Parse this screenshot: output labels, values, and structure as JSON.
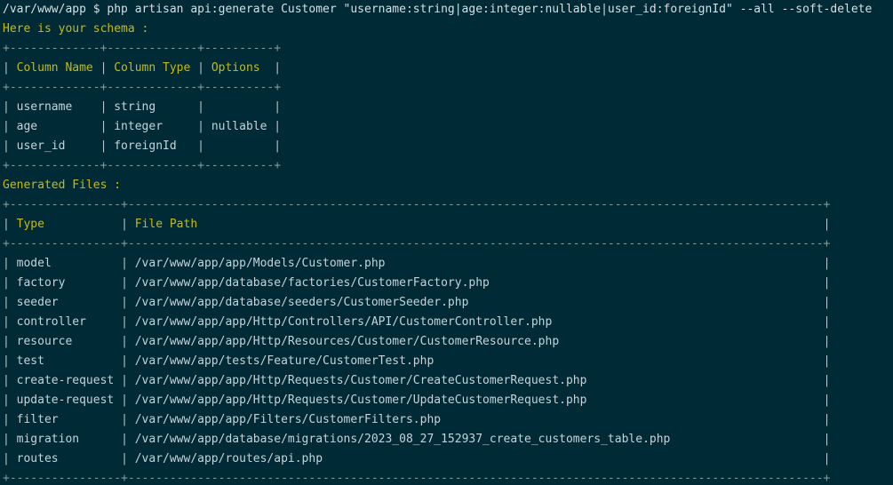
{
  "terminal": {
    "command_line": "/var/www/app $ php artisan api:generate Customer \"username:string|age:integer:nullable|user_id:foreignId\" --all --soft-delete",
    "schema_heading": "Here is your schema :",
    "schema_table": {
      "border": "+-------------+-------------+----------+",
      "header": [
        "Column Name",
        "Column Type",
        "Options"
      ],
      "col_widths": [
        13,
        13,
        10
      ],
      "rows": [
        [
          "username",
          "string",
          ""
        ],
        [
          "age",
          "integer",
          "nullable"
        ],
        [
          "user_id",
          "foreignId",
          ""
        ]
      ]
    },
    "files_heading": "Generated Files :",
    "files_table": {
      "border": "+----------------+----------------------------------------------------------------------------------------------------+",
      "header": [
        "Type",
        "File Path"
      ],
      "col_widths": [
        16,
        100
      ],
      "rows": [
        [
          "model",
          "/var/www/app/app/Models/Customer.php"
        ],
        [
          "factory",
          "/var/www/app/database/factories/CustomerFactory.php"
        ],
        [
          "seeder",
          "/var/www/app/database/seeders/CustomerSeeder.php"
        ],
        [
          "controller",
          "/var/www/app/app/Http/Controllers/API/CustomerController.php"
        ],
        [
          "resource",
          "/var/www/app/app/Http/Resources/Customer/CustomerResource.php"
        ],
        [
          "test",
          "/var/www/app/tests/Feature/CustomerTest.php"
        ],
        [
          "create-request",
          "/var/www/app/app/Http/Requests/Customer/CreateCustomerRequest.php"
        ],
        [
          "update-request",
          "/var/www/app/app/Http/Requests/Customer/UpdateCustomerRequest.php"
        ],
        [
          "filter",
          "/var/www/app/app/Filters/CustomerFilters.php"
        ],
        [
          "migration",
          "/var/www/app/database/migrations/2023_08_27_152937_create_customers_table.php"
        ],
        [
          "routes",
          "/var/www/app/routes/api.php"
        ]
      ]
    },
    "colors": {
      "background": "#002b36",
      "heading": "#c6b915",
      "text": "#c6d2d8"
    }
  }
}
